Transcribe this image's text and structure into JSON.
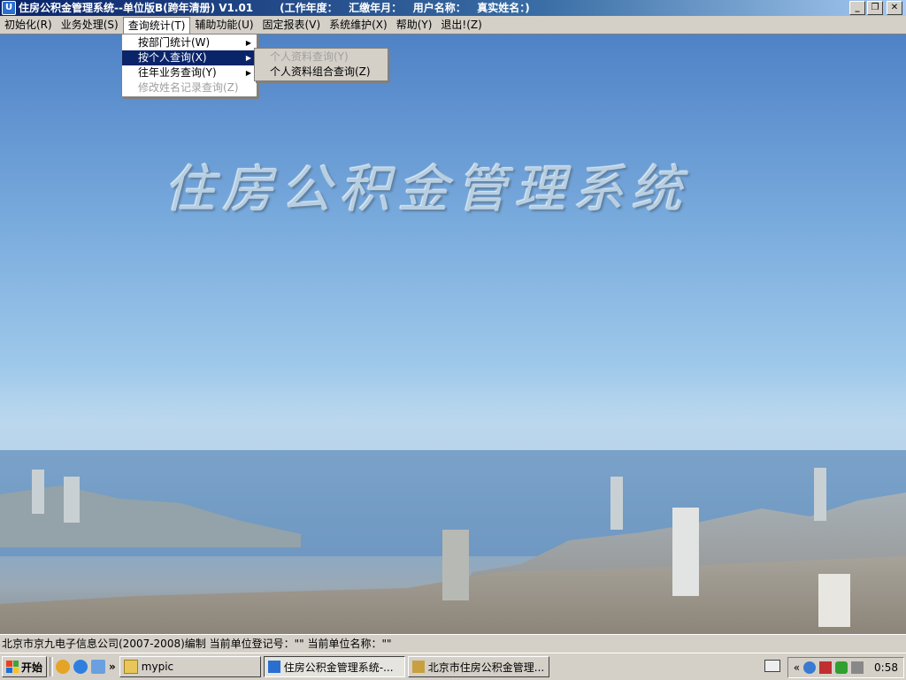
{
  "window": {
    "title": "住房公积金管理系统--单位版B(跨年清册) V1.01",
    "info": "(工作年度：   汇缴年月：   用户名称：   真实姓名：)",
    "controls": [
      "_",
      "❐",
      "✕"
    ]
  },
  "menubar": {
    "items": [
      {
        "label": "初始化(R)"
      },
      {
        "label": "业务处理(S)"
      },
      {
        "label": "查询统计(T)"
      },
      {
        "label": "辅助功能(U)"
      },
      {
        "label": "固定报表(V)"
      },
      {
        "label": "系统维护(X)"
      },
      {
        "label": "帮助(Y)"
      },
      {
        "label": "退出!(Z)"
      }
    ]
  },
  "query_menu": {
    "items": [
      {
        "label": "按部门统计(W)",
        "submenu": true
      },
      {
        "label": "按个人查询(X)",
        "submenu": true,
        "selected": true
      },
      {
        "label": "往年业务查询(Y)",
        "submenu": true
      },
      {
        "label": "修改姓名记录查询(Z)",
        "disabled": true
      }
    ]
  },
  "personal_submenu": {
    "items": [
      {
        "label": "个人资料查询(Y)",
        "disabled": true
      },
      {
        "label": "个人资料组合查询(Z)"
      }
    ]
  },
  "background": {
    "logo_text": "住房公积金管理系统"
  },
  "statusbar": {
    "text": "北京市京九电子信息公司(2007-2008)编制   当前单位登记号：\"\"  当前单位名称：\"\""
  },
  "taskbar": {
    "start_label": "开始",
    "chevron": "»",
    "tasks": [
      {
        "label": "mypic"
      },
      {
        "label": "住房公积金管理系统-..."
      },
      {
        "label": "北京市住房公积金管理..."
      }
    ],
    "tray_chevron": "«",
    "clock": "0:58"
  },
  "colors": {
    "titlebar": "#0a246a",
    "menu_selected": "#0a246a",
    "chrome": "#d4d0c8"
  }
}
